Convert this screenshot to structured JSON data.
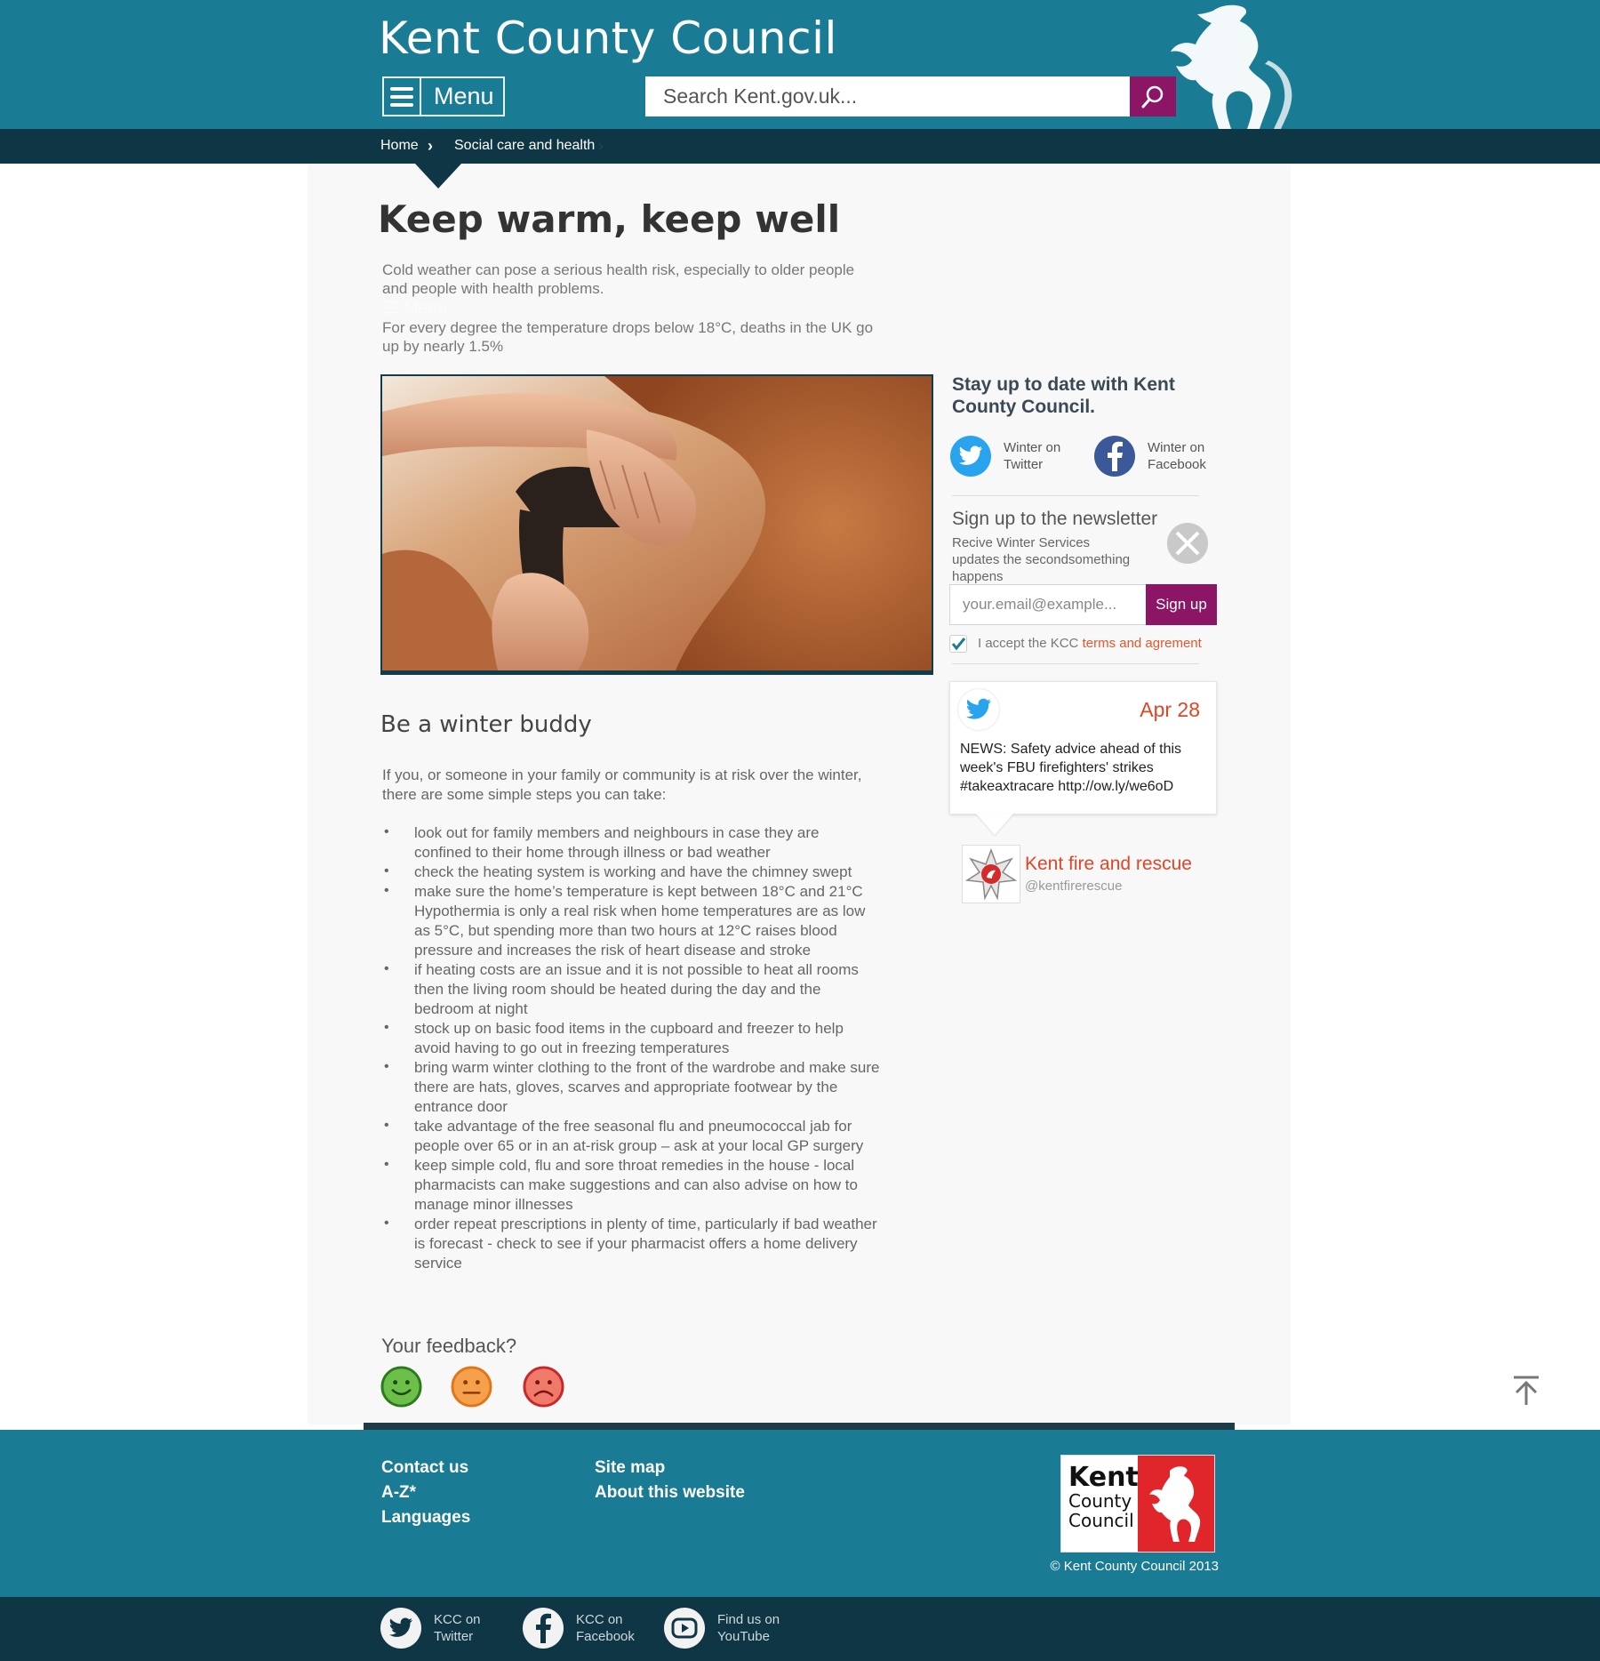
{
  "header": {
    "title": "Kent County Council",
    "menu_label": "Menu",
    "search_placeholder": "Search Kent.gov.uk..."
  },
  "breadcrumb": {
    "items": [
      "Home",
      "Social care and health"
    ]
  },
  "page": {
    "title": "Keep warm, keep well",
    "intro": [
      "Cold weather can pose a serious health risk, especially to older people and people with health problems.",
      "For every degree the temperature drops below 18°C, deaths in the UK go up by nearly 1.5%"
    ],
    "ghost_menu": "Menu",
    "section_title": "Be a winter buddy",
    "section_text": "If you, or someone in your family or community is at risk over the winter, there are some simple steps you can take:",
    "tips": [
      "look out for family members and neighbours in case they are confined to their home through illness or bad weather",
      "check the heating system is working and have the chimney swept",
      "make sure the home’s temperature is kept between 18°C and 21°C Hypothermia is only a real risk when home temperatures are as low as 5°C, but spending more than two hours at 12°C raises blood pressure and increases the risk of heart disease and stroke",
      "if heating costs are an issue and it is not possible to heat all rooms then the living room should be heated during the day and the bedroom at night",
      "stock up on basic food items in the cupboard and freezer to help avoid having to go out in freezing temperatures",
      "bring warm winter clothing to the front of the wardrobe and make sure there are hats, gloves, scarves and appropriate footwear by the entrance door",
      "take advantage of the free seasonal flu and pneumococcal jab for people over 65 or in an at-risk group – ask at your local GP surgery",
      "keep simple cold, flu and sore throat remedies in the house - local pharmacists can make suggestions and can also advise on how to manage minor illnesses",
      "order repeat prescriptions in plenty of time, particularly if bad weather is forecast - check to see if your pharmacist offers a home delivery service"
    ],
    "feedback_title": "Your feedback?"
  },
  "sidebar": {
    "stay_title": "Stay up to date with Kent County Council.",
    "twitter_label": "Winter on Twitter",
    "facebook_label": "Winter on Facebook",
    "newsletter_title": "Sign up to the newsletter",
    "newsletter_desc": "Recive Winter Services updates the secondsomething happens",
    "email_placeholder": "your.email@example...",
    "signup_label": "Sign up",
    "accept_prefix": "I accept the KCC ",
    "accept_link": "terms and agrement",
    "accept_checked": true,
    "tweet": {
      "date": "Apr 28",
      "text": "NEWS: Safety advice ahead of this week's FBU firefighters' strikes #takeaxtracare http://ow.ly/we6oD",
      "author_name": "Kent fire and rescue",
      "author_handle": "@kentfirerescue"
    }
  },
  "footer": {
    "links_col1": [
      "Contact us",
      "A-Z*",
      "Languages"
    ],
    "links_col2": [
      "Site map",
      "About this website"
    ],
    "logo_text": [
      "Kent",
      "County",
      "Council"
    ],
    "copyright": "© Kent County Council 2013",
    "social": {
      "twitter": "KCC on Twitter",
      "facebook": "KCC on Facebook",
      "youtube": "Find us on YouTube"
    }
  },
  "colors": {
    "brand_teal": "#1a7b94",
    "dark_navy": "#0e3645",
    "accent_purple": "#8d1566",
    "accent_orange": "#e04526",
    "twitter_blue": "#2aa3ef",
    "facebook_blue": "#3b5998"
  }
}
